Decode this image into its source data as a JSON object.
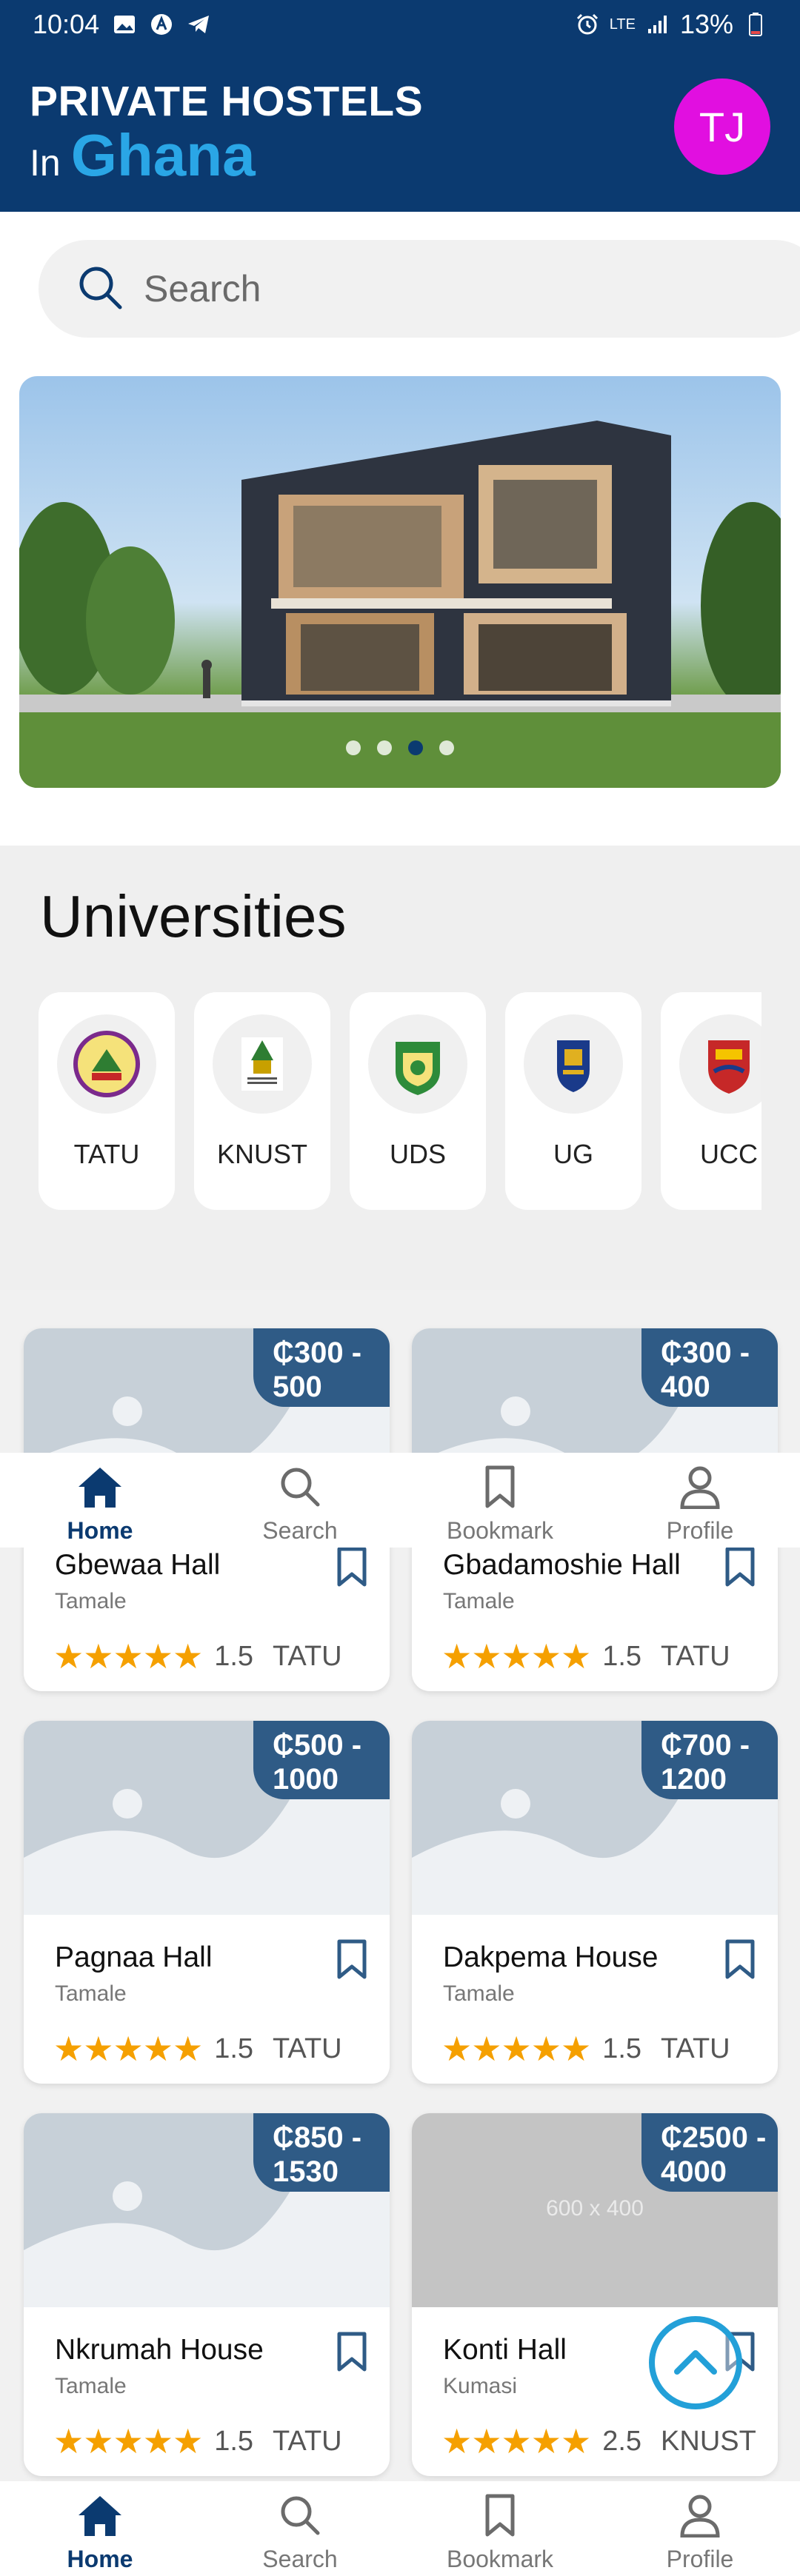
{
  "status_bar": {
    "time": "10:04",
    "network": "LTE",
    "battery": "13%"
  },
  "header": {
    "title_line1": "PRIVATE HOSTELS",
    "title_prefix": "In",
    "title_highlight": "Ghana",
    "avatar_initials": "TJ"
  },
  "search": {
    "placeholder": "Search"
  },
  "banner": {
    "slide_count": 4,
    "active_slide": 3
  },
  "universities": {
    "title": "Universities",
    "items": [
      {
        "label": "TATU"
      },
      {
        "label": "KNUST"
      },
      {
        "label": "UDS"
      },
      {
        "label": "UG"
      },
      {
        "label": "UCC"
      }
    ]
  },
  "hostels": [
    {
      "price": "₵300 - 500",
      "name": "Gbewaa Hall",
      "location": "Tamale",
      "stars": "★★★★★",
      "rating": "1.5",
      "university": "TATU"
    },
    {
      "price": "₵300 - 400",
      "name": "Gbadamoshie Hall",
      "location": "Tamale",
      "stars": "★★★★★",
      "rating": "1.5",
      "university": "TATU"
    },
    {
      "price": "₵500 - 1000",
      "name": "Pagnaa Hall",
      "location": "Tamale",
      "stars": "★★★★★",
      "rating": "1.5",
      "university": "TATU"
    },
    {
      "price": "₵700 - 1200",
      "name": "Dakpema House",
      "location": "Tamale",
      "stars": "★★★★★",
      "rating": "1.5",
      "university": "TATU"
    },
    {
      "price": "₵850 - 1530",
      "name": "Nkrumah House",
      "location": "Tamale",
      "stars": "★★★★★",
      "rating": "1.5",
      "university": "TATU"
    },
    {
      "price": "₵2500 - 4000",
      "name": "Konti Hall",
      "location": "Kumasi",
      "stars": "★★★★★",
      "rating": "2.5",
      "university": "KNUST",
      "image_placeholder": "600 x 400"
    }
  ],
  "nav": {
    "home": "Home",
    "search": "Search",
    "bookmark": "Bookmark",
    "profile": "Profile"
  },
  "colors": {
    "primary": "#0b3a70",
    "accent": "#2aa6e6",
    "avatar": "#e10fe0",
    "star": "#f5a000",
    "price_tag": "#2f5b86"
  }
}
